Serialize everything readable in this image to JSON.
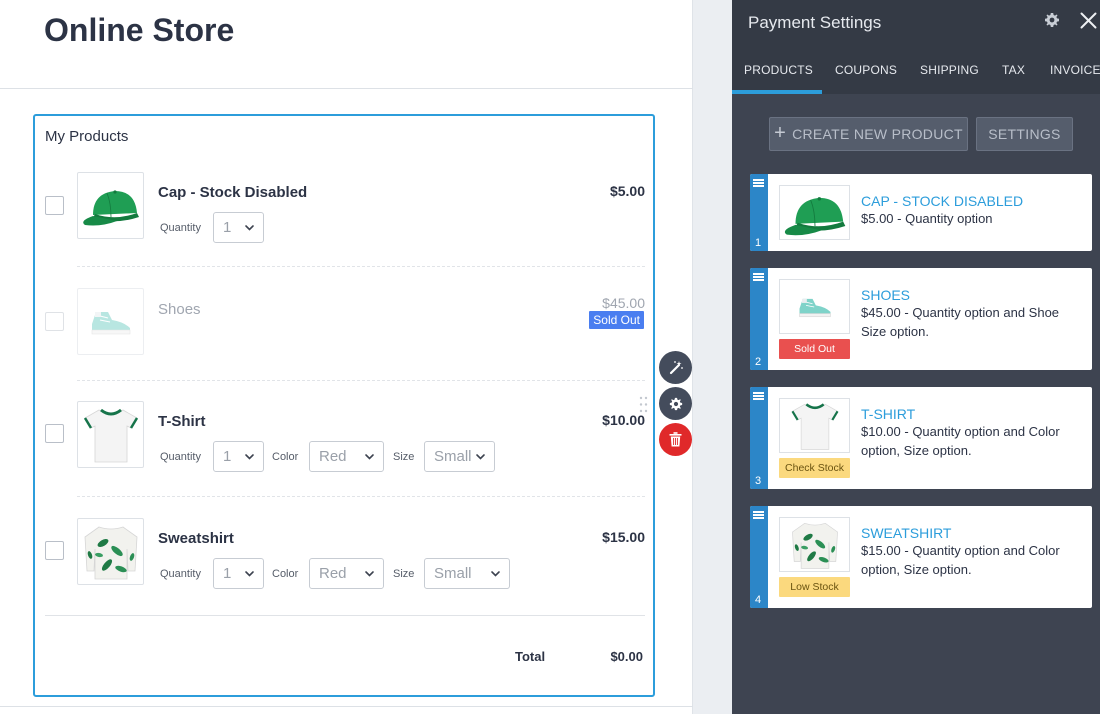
{
  "page": {
    "title": "Online Store"
  },
  "form": {
    "section_title": "My Products",
    "quantity_label": "Quantity",
    "color_label": "Color",
    "size_label": "Size",
    "products": [
      {
        "name": "Cap - Stock Disabled",
        "price": "$5.00",
        "quantity": "1",
        "image": "green-cap-image",
        "checked": false
      },
      {
        "name": "Shoes",
        "price": "$45.00",
        "badge": "Sold Out",
        "image": "sneaker-image",
        "disabled": true
      },
      {
        "name": "T-Shirt",
        "price": "$10.00",
        "quantity": "1",
        "color": "Red",
        "size": "Small",
        "image": "tshirt-image"
      },
      {
        "name": "Sweatshirt",
        "price": "$15.00",
        "quantity": "1",
        "color": "Red",
        "size": "Small",
        "image": "sweatshirt-image"
      }
    ],
    "total_label": "Total",
    "total_value": "$0.00"
  },
  "field_tools": [
    "wand-icon",
    "gear-icon",
    "trash-icon"
  ],
  "panel": {
    "title": "Payment Settings",
    "tabs": [
      "PRODUCTS",
      "COUPONS",
      "SHIPPING",
      "TAX",
      "INVOICE"
    ],
    "active_tab": "PRODUCTS",
    "create_button": "CREATE NEW PRODUCT",
    "settings_button": "SETTINGS",
    "cards": [
      {
        "number": "1",
        "title": "CAP - STOCK DISABLED",
        "description": "$5.00 - Quantity option"
      },
      {
        "number": "2",
        "title": "SHOES",
        "description": "$45.00 - Quantity option and Shoe Size option.",
        "badge": "Sold Out"
      },
      {
        "number": "3",
        "title": "T-SHIRT",
        "description": "$10.00 - Quantity option and Color option, Size option.",
        "badge": "Check Stock"
      },
      {
        "number": "4",
        "title": "SWEATSHIRT",
        "description": "$15.00 - Quantity option and Color option, Size option.",
        "badge": "Low Stock"
      }
    ]
  },
  "colors": {
    "accent": "#2c9ddb",
    "panel_bg": "#3e4451",
    "sold_out_badge": "#4a7ef0",
    "danger": "#e0292a",
    "stock_warning": "#fbd97e"
  }
}
